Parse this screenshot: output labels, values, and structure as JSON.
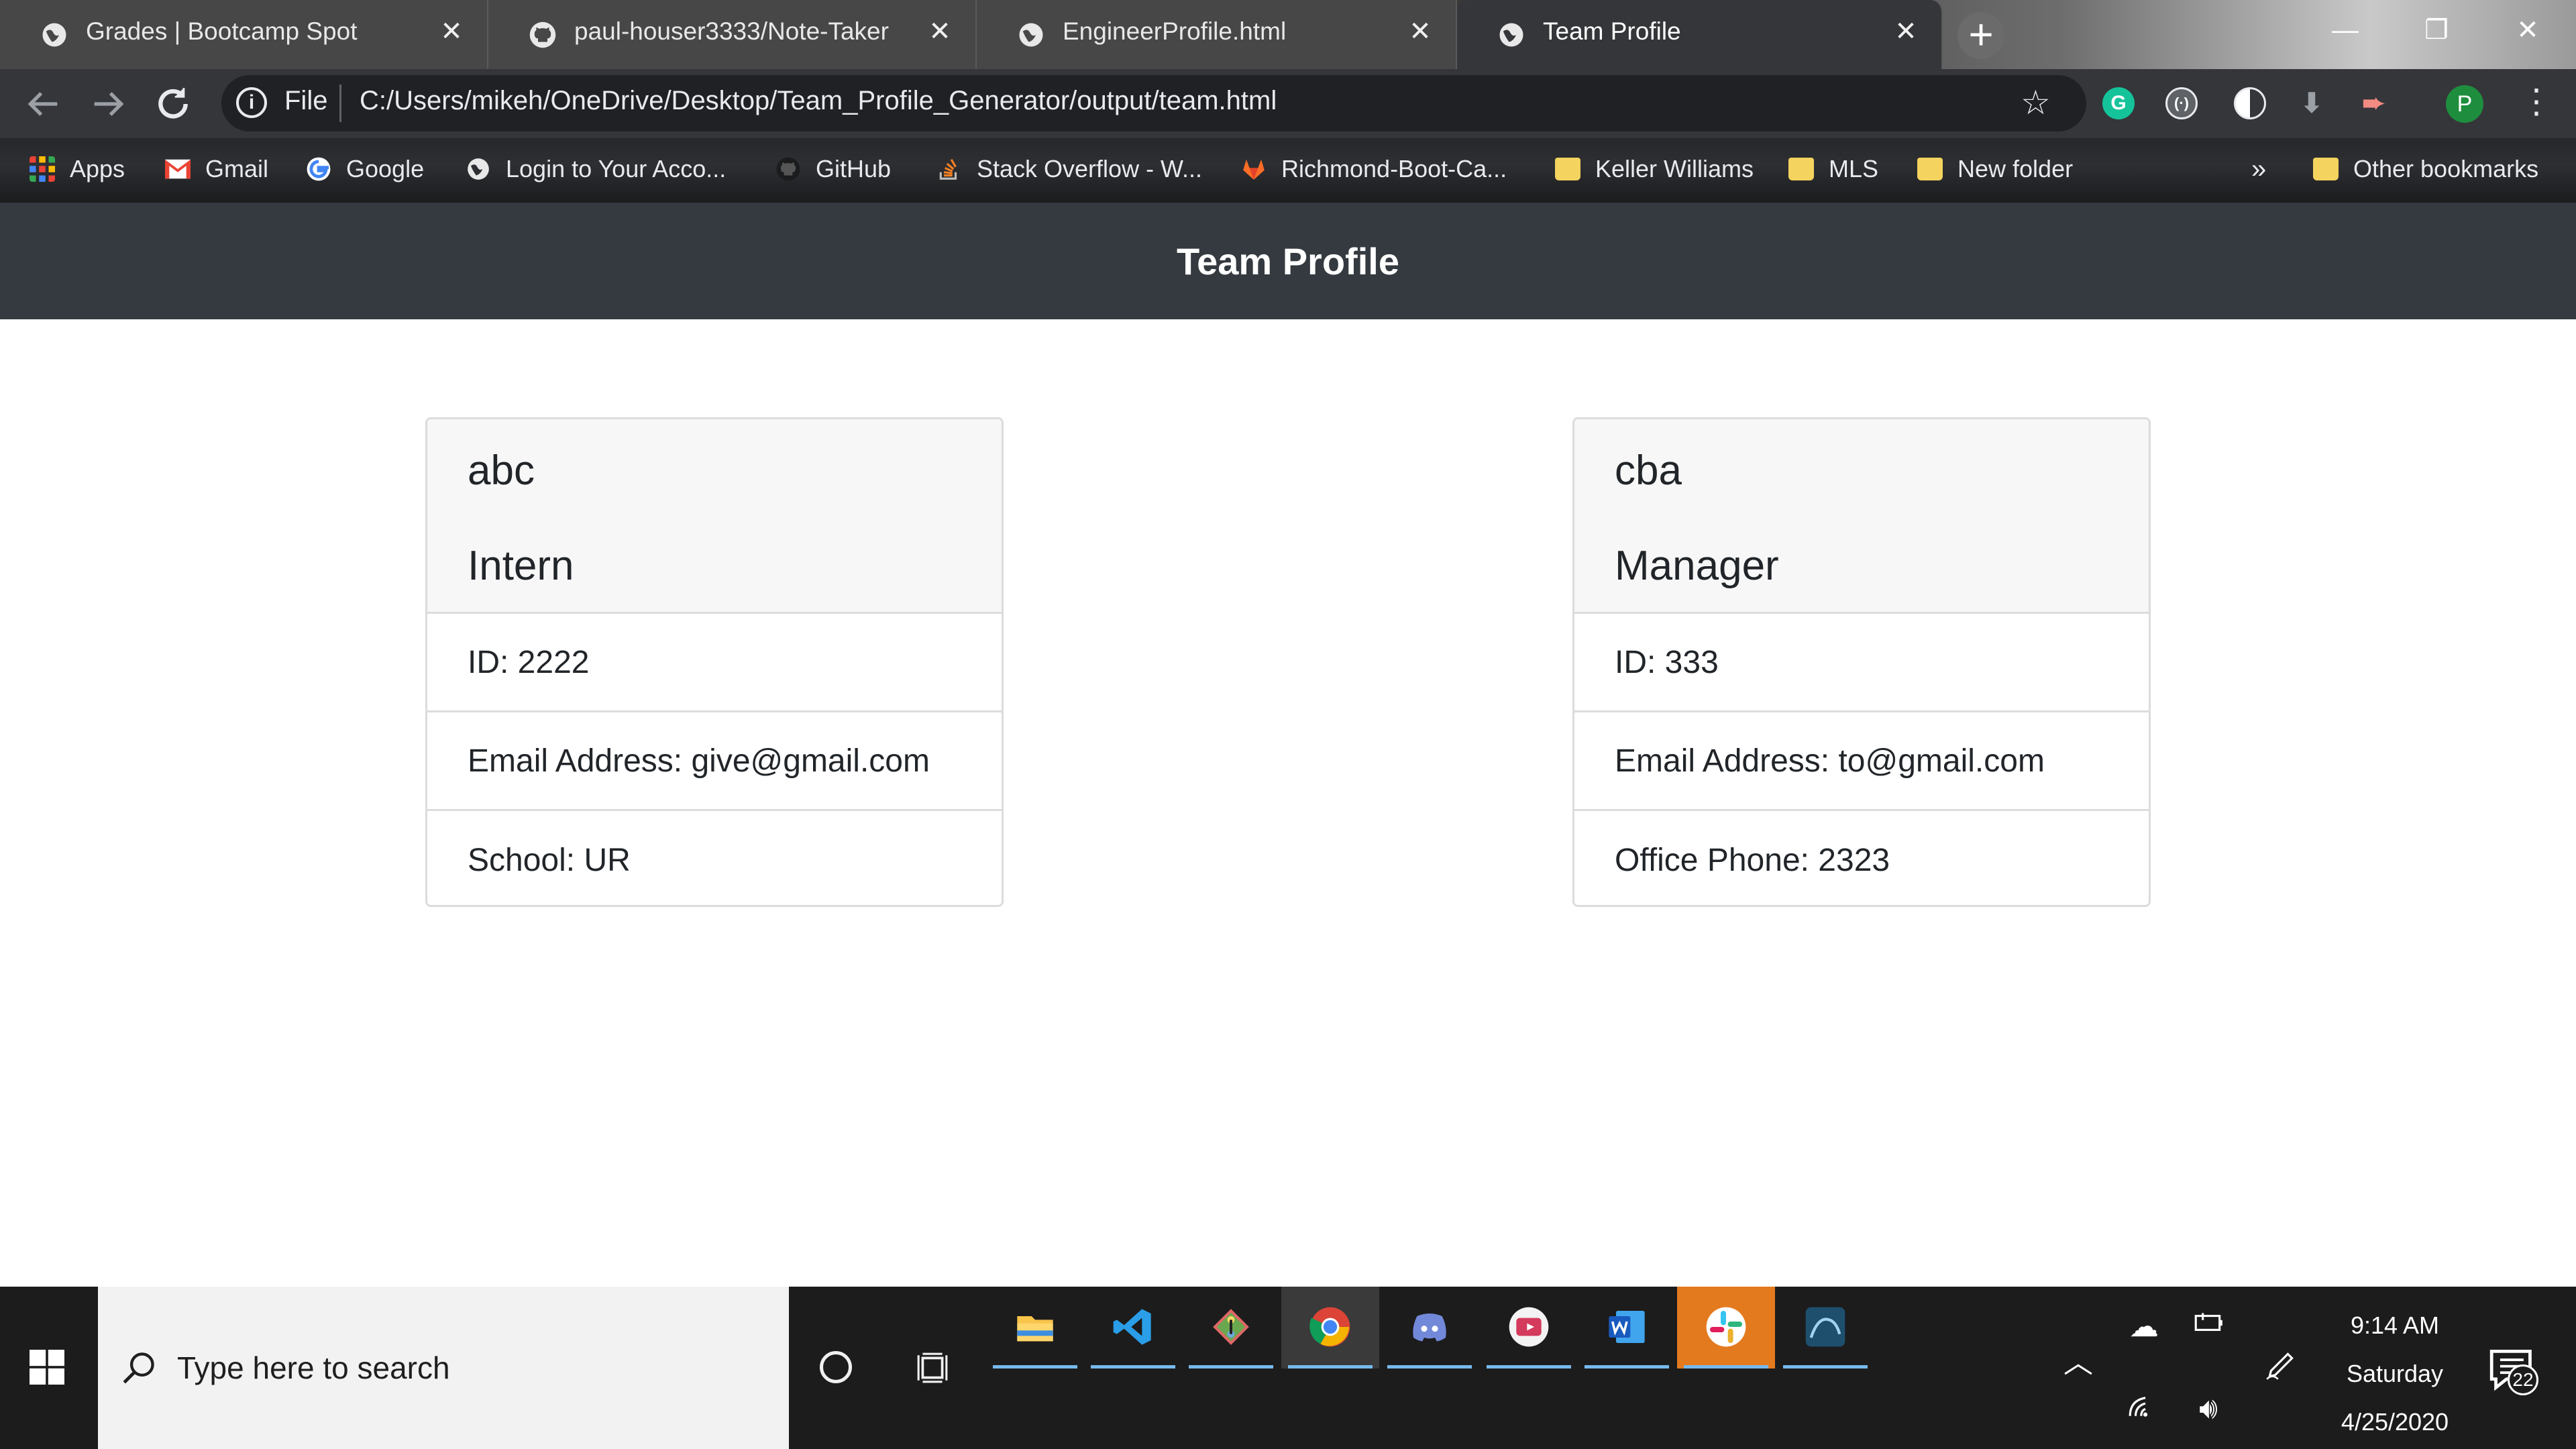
{
  "browser": {
    "tabs": [
      {
        "title": "Grades | Bootcamp Spot",
        "icon": "globe-icon",
        "active": false
      },
      {
        "title": "paul-houser3333/Note-Taker",
        "icon": "github-icon",
        "active": false
      },
      {
        "title": "EngineerProfile.html",
        "icon": "globe-icon",
        "active": false
      },
      {
        "title": "Team Profile",
        "icon": "globe-icon",
        "active": true
      }
    ],
    "close_glyph": "✕",
    "new_tab_glyph": "+",
    "window_controls": {
      "minimize": "—",
      "restore": "❐",
      "close": "✕"
    },
    "address": {
      "scheme_label": "File",
      "url": "C:/Users/mikeh/OneDrive/Desktop/Team_Profile_Generator/output/team.html"
    },
    "profile_initial": "P",
    "bookmarks": [
      {
        "label": "Apps",
        "icon": "apps-grid-icon"
      },
      {
        "label": "Gmail",
        "icon": "gmail-icon"
      },
      {
        "label": "Google",
        "icon": "google-icon"
      },
      {
        "label": "Login to Your Acco...",
        "icon": "globe-icon"
      },
      {
        "label": "GitHub",
        "icon": "github-icon"
      },
      {
        "label": "Stack Overflow - W...",
        "icon": "stackoverflow-icon"
      },
      {
        "label": "Richmond-Boot-Ca...",
        "icon": "gitlab-icon"
      },
      {
        "label": "Keller Williams",
        "icon": "folder-icon"
      },
      {
        "label": "MLS",
        "icon": "folder-icon"
      },
      {
        "label": "New folder",
        "icon": "folder-icon"
      }
    ],
    "bookmarks_overflow": "»",
    "other_bookmarks": "Other bookmarks"
  },
  "page": {
    "title": "Team Profile",
    "cards": [
      {
        "name": "abc",
        "role": "Intern",
        "id_line": "ID: 2222",
        "email_line": "Email Address: give@gmail.com",
        "extra_line": "School: UR"
      },
      {
        "name": "cba",
        "role": "Manager",
        "id_line": "ID: 333",
        "email_line": "Email Address: to@gmail.com",
        "extra_line": "Office Phone: 2323"
      }
    ]
  },
  "taskbar": {
    "search_placeholder": "Type here to search",
    "pinned_apps": [
      "file-explorer-icon",
      "vscode-icon",
      "git-icon",
      "chrome-icon",
      "discord-icon",
      "screen-recorder-icon",
      "word-icon",
      "slack-icon",
      "mysql-icon"
    ],
    "clock": {
      "time": "9:14 AM",
      "day": "Saturday",
      "date": "4/25/2020"
    },
    "notification_count": "22"
  },
  "colors": {
    "header_bg": "#343a40",
    "card_header_bg": "#f7f7f7",
    "card_border": "#dcdcdc",
    "taskbar_bg": "#1c1c1c",
    "slack_highlight": "#e47a1e"
  }
}
